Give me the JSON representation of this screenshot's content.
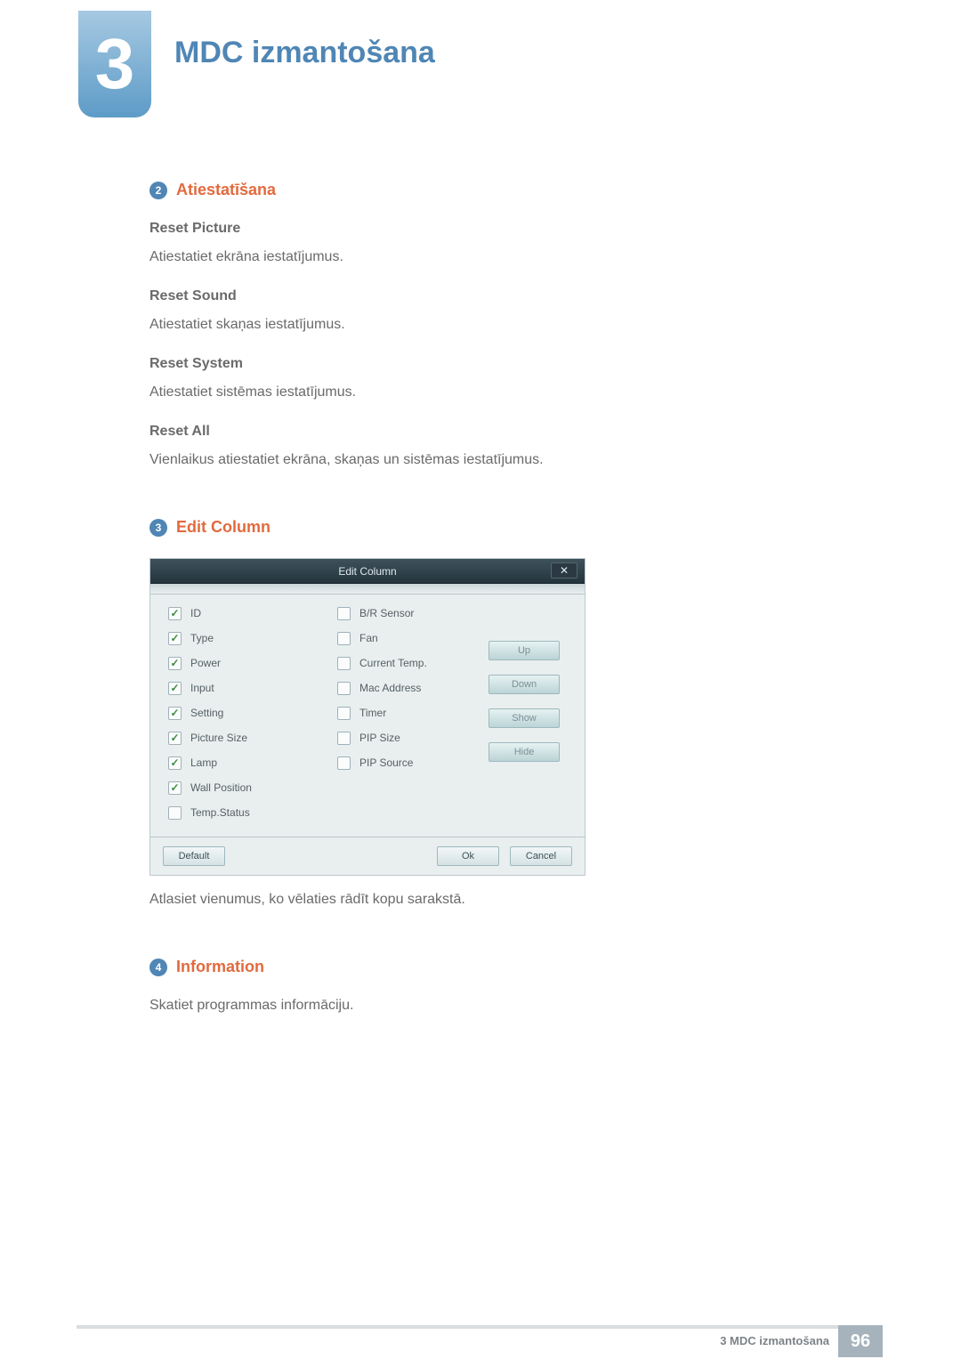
{
  "chapter": {
    "number": "3",
    "title": "MDC izmantošana"
  },
  "sections": {
    "two": {
      "num": "2",
      "title": "Atiestatīšana",
      "items": [
        {
          "heading": "Reset Picture",
          "text": "Atiestatiet ekrāna iestatījumus."
        },
        {
          "heading": "Reset Sound",
          "text": "Atiestatiet skaņas iestatījumus."
        },
        {
          "heading": "Reset System",
          "text": "Atiestatiet sistēmas iestatījumus."
        },
        {
          "heading": "Reset All",
          "text": "Vienlaikus atiestatiet ekrāna, skaņas un sistēmas iestatījumus."
        }
      ]
    },
    "three": {
      "num": "3",
      "title": "Edit Column",
      "dialog": {
        "title": "Edit Column",
        "left_items": [
          {
            "label": "ID",
            "checked": true
          },
          {
            "label": "Type",
            "checked": true
          },
          {
            "label": "Power",
            "checked": true
          },
          {
            "label": "Input",
            "checked": true
          },
          {
            "label": "Setting",
            "checked": true
          },
          {
            "label": "Picture Size",
            "checked": true
          },
          {
            "label": "Lamp",
            "checked": true
          },
          {
            "label": "Wall Position",
            "checked": true
          },
          {
            "label": "Temp.Status",
            "checked": false
          }
        ],
        "mid_items": [
          {
            "label": "B/R Sensor",
            "checked": false
          },
          {
            "label": "Fan",
            "checked": false
          },
          {
            "label": "Current Temp.",
            "checked": false
          },
          {
            "label": "Mac Address",
            "checked": false
          },
          {
            "label": "Timer",
            "checked": false
          },
          {
            "label": "PIP Size",
            "checked": false
          },
          {
            "label": "PIP Source",
            "checked": false
          }
        ],
        "side_buttons": {
          "up": "Up",
          "down": "Down",
          "show": "Show",
          "hide": "Hide"
        },
        "footer_buttons": {
          "default": "Default",
          "ok": "Ok",
          "cancel": "Cancel"
        }
      },
      "caption": "Atlasiet vienumus, ko vēlaties rādīt kopu sarakstā."
    },
    "four": {
      "num": "4",
      "title": "Information",
      "text": "Skatiet programmas informāciju."
    }
  },
  "footer": {
    "section_label": "3 MDC izmantošana",
    "page": "96"
  }
}
